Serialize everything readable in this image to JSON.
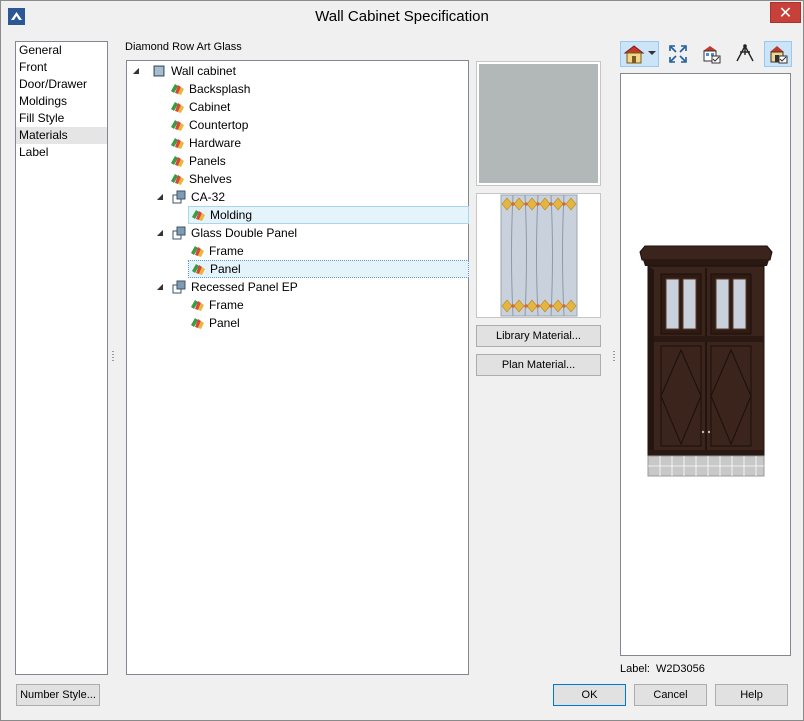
{
  "window": {
    "title": "Wall Cabinet Specification",
    "close_glyph": "✕"
  },
  "nav": {
    "items": [
      {
        "label": "General",
        "selected": false
      },
      {
        "label": "Front",
        "selected": false
      },
      {
        "label": "Door/Drawer",
        "selected": false
      },
      {
        "label": "Moldings",
        "selected": false
      },
      {
        "label": "Fill Style",
        "selected": false
      },
      {
        "label": "Materials",
        "selected": true
      },
      {
        "label": "Label",
        "selected": false
      }
    ]
  },
  "materials": {
    "current_material": "Diamond Row Art Glass",
    "tree": [
      {
        "label": "Wall cabinet",
        "icon": "cube-icon",
        "expander": "◢"
      },
      {
        "label": "Backsplash",
        "icon": "material-icon"
      },
      {
        "label": "Cabinet",
        "icon": "material-icon"
      },
      {
        "label": "Countertop",
        "icon": "material-icon"
      },
      {
        "label": "Hardware",
        "icon": "material-icon"
      },
      {
        "label": "Panels",
        "icon": "material-icon"
      },
      {
        "label": "Shelves",
        "icon": "material-icon"
      },
      {
        "label": "CA-32",
        "icon": "component-icon",
        "expander": "◢"
      },
      {
        "label": "Molding",
        "icon": "material-icon",
        "state": "highlighted"
      },
      {
        "label": "Glass Double Panel",
        "icon": "component-icon",
        "expander": "◢"
      },
      {
        "label": "Frame",
        "icon": "material-icon"
      },
      {
        "label": "Panel",
        "icon": "material-icon",
        "state": "selected"
      },
      {
        "label": "Recessed Panel EP",
        "icon": "component-icon",
        "expander": "◢"
      },
      {
        "label": "Frame",
        "icon": "material-icon"
      },
      {
        "label": "Panel",
        "icon": "material-icon"
      }
    ],
    "swatch_color": "#b2b7b8",
    "library_button": "Library Material...",
    "plan_button": "Plan Material..."
  },
  "preview": {
    "label_caption": "Label:",
    "label_value": "W2D3056",
    "toolbar": [
      {
        "icon": "house-view-icon",
        "active": true
      },
      {
        "icon": "fit-window-icon",
        "active": false
      },
      {
        "icon": "camera-settings-icon",
        "active": false
      },
      {
        "icon": "perspective-icon",
        "active": false
      },
      {
        "icon": "render-options-icon",
        "active": true
      }
    ],
    "colors": {
      "cabinet": "#3a241b",
      "backsplash": "#c8c8c8"
    }
  },
  "footer": {
    "number_style": "Number Style...",
    "ok": "OK",
    "cancel": "Cancel",
    "help": "Help"
  }
}
